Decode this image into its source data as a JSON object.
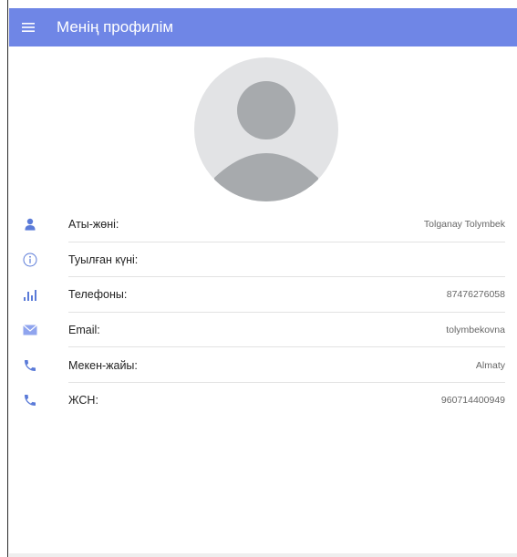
{
  "appbar": {
    "title": "Менің профилім",
    "menu_icon": "hamburger-menu-icon",
    "background": "#6f86e6"
  },
  "avatar": {
    "icon": "person-silhouette"
  },
  "profile": {
    "rows": [
      {
        "label": "Аты-жөні:",
        "value": "Tolganay Tolymbek",
        "icon": "person-icon"
      },
      {
        "label": "Туылған күні:",
        "value": "",
        "icon": "info-icon"
      },
      {
        "label": "Телефоны:",
        "value": "87476276058",
        "icon": "signal-bars-icon"
      },
      {
        "label": "Email:",
        "value": "tolymbekovna",
        "icon": "envelope-icon"
      },
      {
        "label": "Мекен-жайы:",
        "value": "Almaty",
        "icon": "phone-icon"
      },
      {
        "label": "ЖСН:",
        "value": "960714400949",
        "icon": "phone-icon"
      }
    ]
  },
  "colors": {
    "accent": "#6f86e6",
    "icon": "#5b7bd8",
    "avatar_bg": "#e2e3e5",
    "avatar_fg": "#a7aaad"
  }
}
